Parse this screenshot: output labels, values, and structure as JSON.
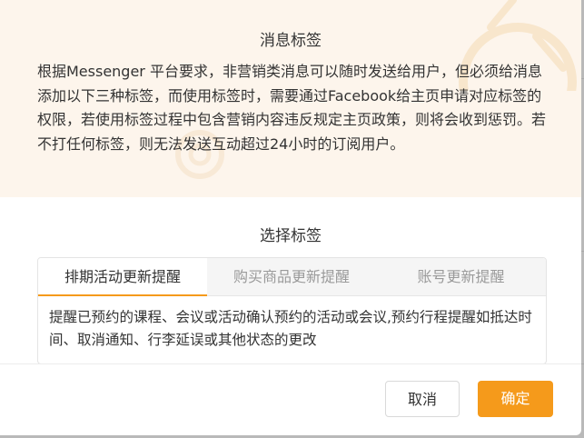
{
  "background": {
    "glyphs": [
      "可",
      "给",
      "2"
    ]
  },
  "modal": {
    "notice": {
      "title": "消息标签",
      "body": "根据Messenger 平台要求，非营销类消息可以随时发送给用户，但必须给消息添加以下三种标签，而使用标签时，需要通过Facebook给主页申请对应标签的权限，若使用标签过程中包含营销内容违反规定主页政策，则将会收到惩罚。若不打任何标签，则无法发送互动超过24小时的订阅用户。"
    },
    "select_title": "选择标签",
    "tabs": [
      {
        "label": "排期活动更新提醒",
        "active": true
      },
      {
        "label": "购买商品更新提醒",
        "active": false
      },
      {
        "label": "账号更新提醒",
        "active": false
      }
    ],
    "tab_content": "提醒已预约的课程、会议或活动确认预约的活动或会议,预约行程提醒如抵达时间、取消通知、行李延误或其他状态的更改",
    "buttons": {
      "cancel": "取消",
      "confirm": "确定"
    }
  },
  "colors": {
    "accent": "#f59a1b",
    "notice_bg": "#fdf5ec",
    "text": "#333333",
    "inactive_tab_text": "#9a9a9a"
  }
}
